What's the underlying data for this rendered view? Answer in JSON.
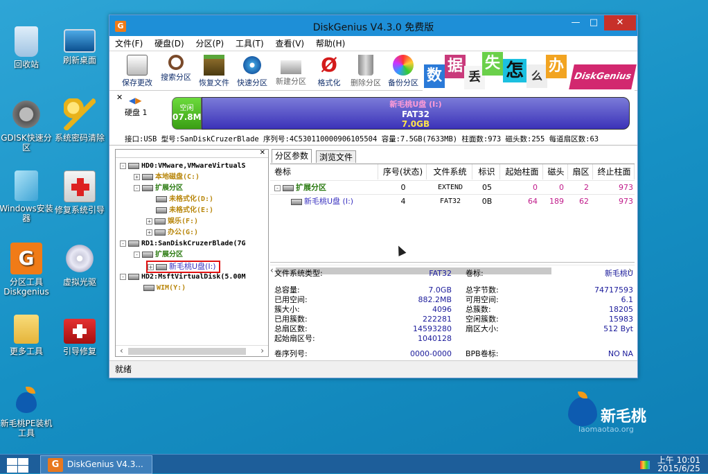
{
  "desktop": {
    "icons": [
      {
        "label": "回收站"
      },
      {
        "label": "刷新桌面"
      },
      {
        "label": "GDISK快速分区"
      },
      {
        "label": "系统密码清除"
      },
      {
        "label": "Windows安装器"
      },
      {
        "label": "修复系统引导"
      },
      {
        "label": "分区工具Diskgenius"
      },
      {
        "label": "虚拟光驱"
      },
      {
        "label": "更多工具"
      },
      {
        "label": "引导修复"
      },
      {
        "label": "新毛桃PE装机工具"
      }
    ],
    "brand_name": "新毛桃",
    "brand_url": "laomaotao.org"
  },
  "taskbar": {
    "app_label": "DiskGenius V4.3...",
    "clock_time": "上午 10:01",
    "clock_date": "2015/6/25"
  },
  "window": {
    "title": "DiskGenius V4.3.0 免费版",
    "menu": [
      "文件(F)",
      "硬盘(D)",
      "分区(P)",
      "工具(T)",
      "查看(V)",
      "帮助(H)"
    ],
    "toolbar": [
      "保存更改",
      "搜索分区",
      "恢复文件",
      "快速分区",
      "新建分区",
      "格式化",
      "删除分区",
      "备份分区"
    ],
    "banner_chars": [
      "数",
      "据",
      "丢",
      "失",
      "怎",
      "么",
      "办"
    ],
    "banner_logo": "DiskGenius",
    "disk_label": "硬盘 1",
    "free_block": {
      "label": "空闲",
      "size": "07.8M"
    },
    "part_block": {
      "name": "新毛桃U盘 (I:)",
      "fs": "FAT32",
      "size": "7.0GB"
    },
    "disk_info": "接口:USB  型号:SanDiskCruzerBlade  序列号:4C530110000906105504  容量:7.5GB(7633MB)  柱面数:973  磁头数:255  每道扇区数:63",
    "tree": [
      {
        "text": "HD0:VMware,VMwareVirtualS"
      },
      {
        "text": "本地磁盘(C:)"
      },
      {
        "text": "扩展分区"
      },
      {
        "text": "未格式化(D:)"
      },
      {
        "text": "未格式化(E:)"
      },
      {
        "text": "娱乐(F:)"
      },
      {
        "text": "办公(G:)"
      },
      {
        "text": "RD1:SanDiskCruzerBlade(7G"
      },
      {
        "text": "扩展分区"
      },
      {
        "text": "新毛桃U盘(I:)"
      },
      {
        "text": "HD2:MsftVirtualDisk(5.00M"
      },
      {
        "text": "WIM(Y:)"
      }
    ],
    "tabs": [
      "分区参数",
      "浏览文件"
    ],
    "columns": [
      "卷标",
      "序号(状态)",
      "文件系统",
      "标识",
      "起始柱面",
      "磁头",
      "扇区",
      "终止柱面"
    ],
    "rows": [
      {
        "name": "扩展分区",
        "seq": "0",
        "fs": "EXTEND",
        "id": "05",
        "start_cyl": "0",
        "head": "0",
        "sector": "2",
        "end_cyl": "973"
      },
      {
        "name": "新毛桃U盘 (I:)",
        "seq": "4",
        "fs": "FAT32",
        "id": "0B",
        "start_cyl": "64",
        "head": "189",
        "sector": "62",
        "end_cyl": "973"
      }
    ],
    "details": {
      "fs_type_label": "文件系统类型:",
      "fs_type": "FAT32",
      "vol_label_label": "卷标:",
      "vol_label": "新毛桃U",
      "total_cap_label": "总容量:",
      "total_cap": "7.0GB",
      "total_bytes_label": "总字节数:",
      "total_bytes": "74717593",
      "used_label": "已用空间:",
      "used": "882.2MB",
      "free_label": "可用空间:",
      "free": "6.1",
      "cluster_size_label": "簇大小:",
      "cluster_size": "4096",
      "total_clusters_label": "总簇数:",
      "total_clusters": "18205",
      "used_clusters_label": "已用簇数:",
      "used_clusters": "222281",
      "free_clusters_label": "空闲簇数:",
      "free_clusters": "15983",
      "total_sectors_label": "总扇区数:",
      "total_sectors": "14593280",
      "sector_size_label": "扇区大小:",
      "sector_size": "512 Byt",
      "start_sector_label": "起始扇区号:",
      "start_sector": "1040128",
      "serial_label": "卷序列号:",
      "serial": "0000-0000",
      "bpb_label": "BPB卷标:",
      "bpb": "NO NA"
    },
    "status": "就绪"
  }
}
